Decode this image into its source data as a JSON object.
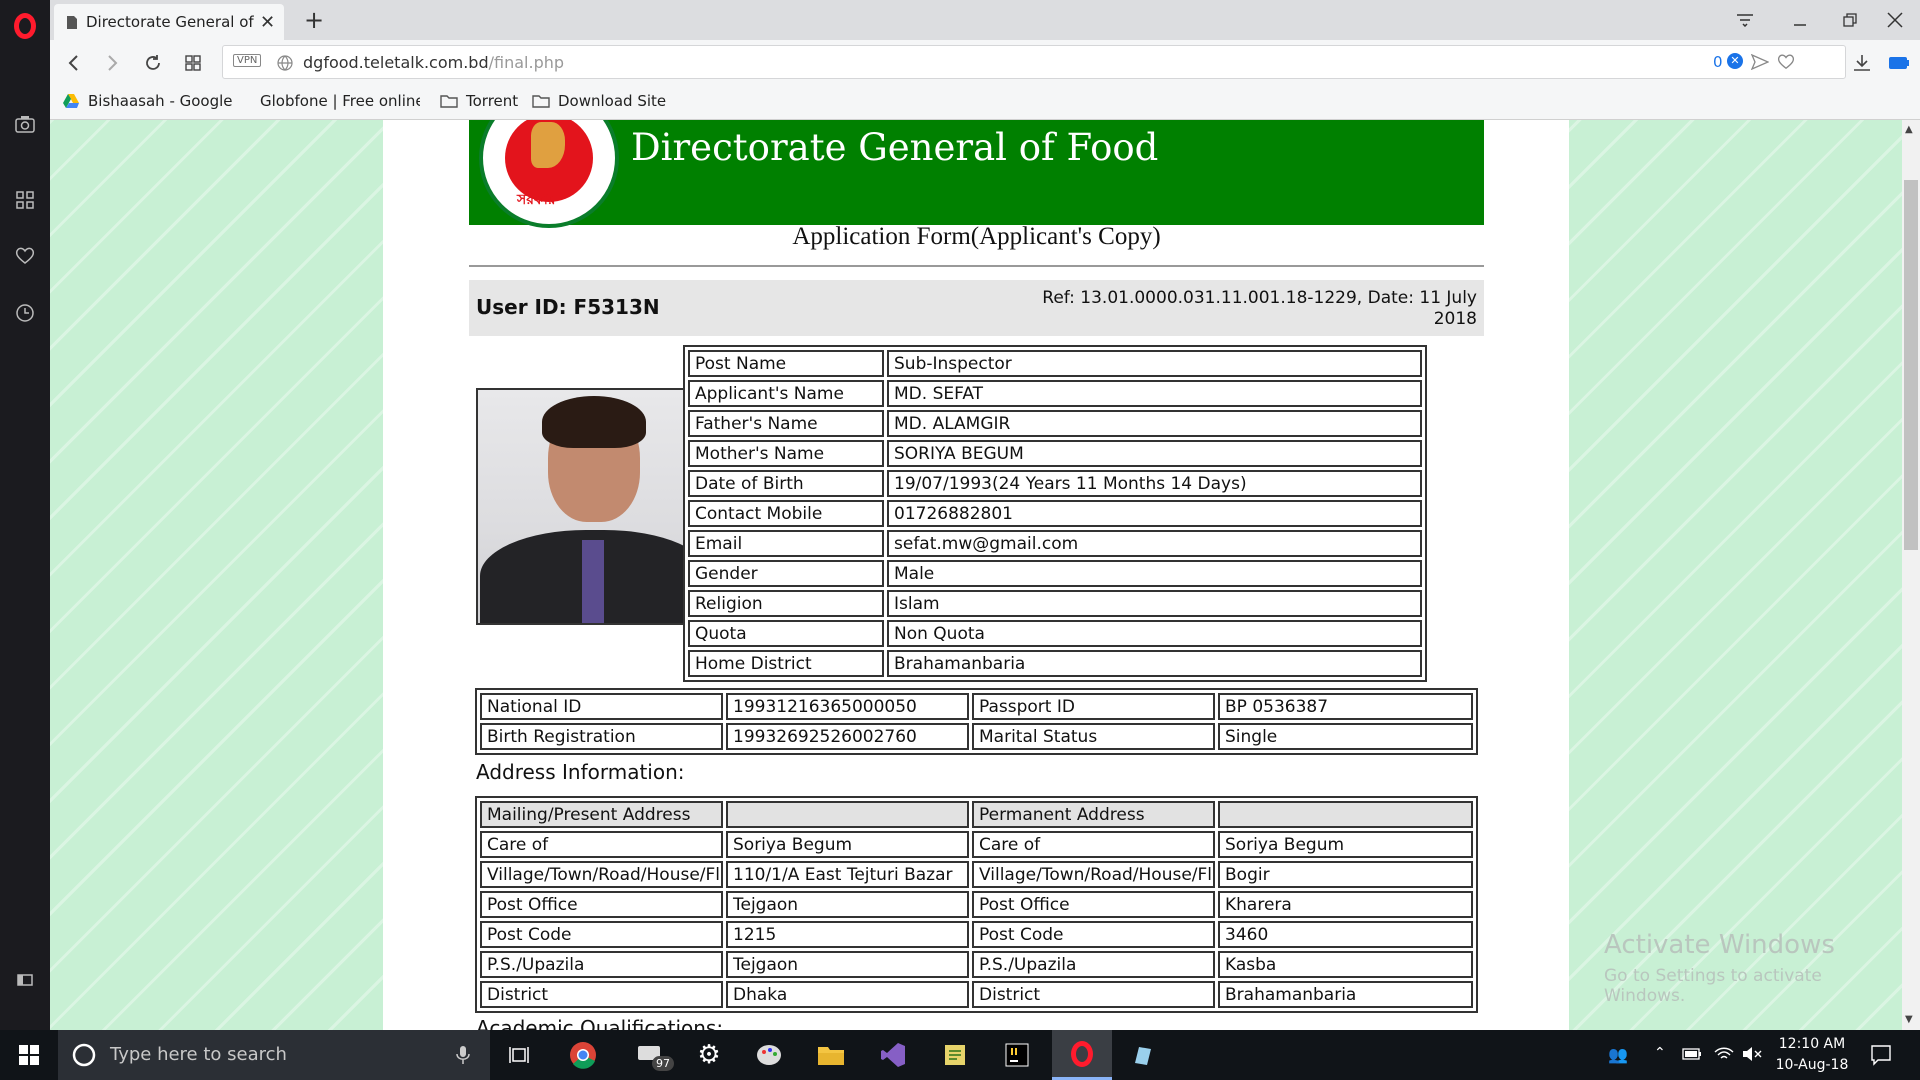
{
  "browser": {
    "tab_title": "Directorate General of Food",
    "url_host": "dgfood.teletalk.com.bd",
    "url_path": "/final.php",
    "vpn_label": "VPN",
    "adblock_count": "0",
    "bookmarks": [
      {
        "label": "Bishaasah - Google",
        "icon": "google-drive-icon"
      },
      {
        "label": "Globfone | Free online",
        "icon": "globfone-icon"
      },
      {
        "label": "Torrent",
        "icon": "folder-icon"
      },
      {
        "label": "Download Site",
        "icon": "folder-icon"
      }
    ]
  },
  "header": {
    "organization": "Directorate General of Food",
    "seal_text": "সরকার",
    "form_title": "Application Form(Applicant's Copy)",
    "user_id": "User ID: F5313N",
    "ref_line1": "Ref: 13.01.0000.031.11.001.18-1229, Date: 11 July",
    "ref_line2": "2018"
  },
  "personal": [
    {
      "label": "Post Name",
      "value": "Sub-Inspector"
    },
    {
      "label": "Applicant's Name",
      "value": "MD. SEFAT"
    },
    {
      "label": "Father's Name",
      "value": "MD. ALAMGIR"
    },
    {
      "label": "Mother's Name",
      "value": "SORIYA BEGUM"
    },
    {
      "label": "Date of Birth",
      "value": "19/07/1993(24 Years 11 Months 14 Days)"
    },
    {
      "label": "Contact Mobile",
      "value": "01726882801"
    },
    {
      "label": "Email",
      "value": "sefat.mw@gmail.com"
    },
    {
      "label": "Gender",
      "value": "Male"
    },
    {
      "label": "Religion",
      "value": "Islam"
    },
    {
      "label": "Quota",
      "value": "Non Quota"
    },
    {
      "label": "Home District",
      "value": "Brahamanbaria"
    }
  ],
  "ids": [
    [
      "National ID",
      "19931216365000050",
      "Passport ID",
      "BP 0536387"
    ],
    [
      "Birth Registration",
      "19932692526002760",
      "Marital Status",
      "Single"
    ]
  ],
  "address": {
    "heading": "Address Information:",
    "header": [
      "Mailing/Present Address",
      "",
      "Permanent Address",
      ""
    ],
    "rows": [
      [
        "Care of",
        "Soriya Begum",
        "Care of",
        "Soriya Begum"
      ],
      [
        "Village/Town/Road/House/Flat",
        "110/1/A East Tejturi Bazar",
        "Village/Town/Road/House/Flat",
        "Bogir"
      ],
      [
        "Post Office",
        "Tejgaon",
        "Post Office",
        "Kharera"
      ],
      [
        "Post Code",
        "1215",
        "Post Code",
        "3460"
      ],
      [
        "P.S./Upazila",
        "Tejgaon",
        "P.S./Upazila",
        "Kasba"
      ],
      [
        "District",
        "Dhaka",
        "District",
        "Brahamanbaria"
      ]
    ]
  },
  "academic_heading": "Academic Qualifications:",
  "watermark": {
    "line1": "Activate Windows",
    "line2": "Go to Settings to activate Windows."
  },
  "taskbar": {
    "search_placeholder": "Type here to search",
    "badge_count": "97",
    "time": "12:10 AM",
    "date": "10-Aug-18"
  },
  "colors": {
    "banner_green": "#008000",
    "page_background": "#c8f0d4",
    "opera_red": "#ff1b2d"
  }
}
